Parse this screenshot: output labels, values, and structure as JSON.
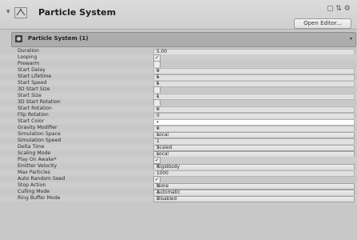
{
  "header": {
    "component_title": "Particle System",
    "open_editor_label": "Open Editor...",
    "fold_icon": "triangle-down-icon",
    "component_icon": "particle-system-icon",
    "help_icon": "help-icon",
    "settings_icon": "gear-icon",
    "header_icons_text": "▢ ⇅ ⚙"
  },
  "module": {
    "title": "Particle System (1)",
    "chevron": "▾"
  },
  "properties": [
    {
      "label": "Duration",
      "type": "number",
      "value": "5.00"
    },
    {
      "label": "Looping",
      "type": "checkbox",
      "checked": true
    },
    {
      "label": "Prewarm",
      "type": "checkbox",
      "checked": false
    },
    {
      "label": "Start Delay",
      "type": "number",
      "value": "0",
      "arrow": "▾"
    },
    {
      "label": "Start Lifetime",
      "type": "number",
      "value": "5",
      "arrow": "▾"
    },
    {
      "label": "Start Speed",
      "type": "number",
      "value": "5",
      "arrow": "▾"
    },
    {
      "label": "3D Start Size",
      "type": "checkbox",
      "checked": false
    },
    {
      "label": "Start Size",
      "type": "number",
      "value": "1",
      "arrow": "▾"
    },
    {
      "label": "3D Start Rotation",
      "type": "checkbox",
      "checked": false
    },
    {
      "label": "Start Rotation",
      "type": "number",
      "value": "0",
      "arrow": "▾"
    },
    {
      "label": "Flip Rotation",
      "type": "number",
      "value": "0"
    },
    {
      "label": "Start Color",
      "type": "color",
      "value": "#ffffff",
      "arrow": "▾"
    },
    {
      "label": "Gravity Modifier",
      "type": "number",
      "value": "0",
      "arrow": "▾"
    },
    {
      "label": "Simulation Space",
      "type": "popup",
      "value": "Local",
      "arrow": "⇕"
    },
    {
      "label": "Simulation Speed",
      "type": "number",
      "value": "1"
    },
    {
      "label": "Delta Time",
      "type": "popup",
      "value": "Scaled",
      "arrow": "⇕"
    },
    {
      "label": "Scaling Mode",
      "type": "popup",
      "value": "Local",
      "arrow": "⇕"
    },
    {
      "label": "Play On Awake*",
      "type": "checkbox",
      "checked": true
    },
    {
      "label": "Emitter Velocity",
      "type": "popup",
      "value": "Rigidbody",
      "arrow": "⇕"
    },
    {
      "label": "Max Particles",
      "type": "number",
      "value": "1000"
    },
    {
      "label": "Auto Random Seed",
      "type": "checkbox",
      "checked": true
    },
    {
      "label": "Stop Action",
      "type": "popup",
      "value": "None",
      "arrow": "⇕"
    },
    {
      "label": "Culling Mode",
      "type": "popup",
      "value": "Automatic",
      "arrow": "⇕"
    },
    {
      "label": "Ring Buffer Mode",
      "type": "popup",
      "value": "Disabled",
      "arrow": "⇕"
    }
  ]
}
